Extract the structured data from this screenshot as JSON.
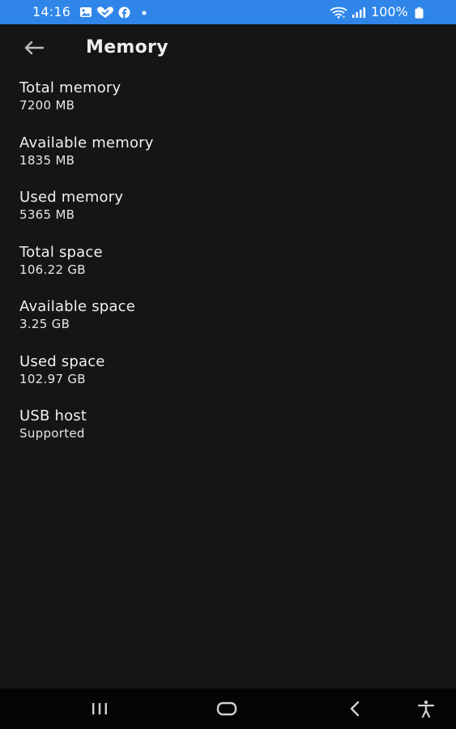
{
  "status_bar": {
    "time": "14:16",
    "battery": "100%",
    "background_color": "#2f86e8",
    "icons": [
      "image-icon",
      "heart-check-icon",
      "facebook-icon",
      "dot-icon",
      "wifi-icon",
      "signal-icon",
      "battery-icon"
    ]
  },
  "app_bar": {
    "title": "Memory",
    "back_icon": "arrow-left-icon"
  },
  "items": [
    {
      "label": "Total memory",
      "value": "7200 MB"
    },
    {
      "label": "Available memory",
      "value": "1835 MB"
    },
    {
      "label": "Used memory",
      "value": "5365 MB"
    },
    {
      "label": "Total space",
      "value": "106.22 GB"
    },
    {
      "label": "Available space",
      "value": "3.25 GB"
    },
    {
      "label": "Used space",
      "value": "102.97 GB"
    },
    {
      "label": "USB host",
      "value": "Supported"
    }
  ],
  "nav_bar": {
    "icons": [
      "recent-apps-icon",
      "home-icon",
      "back-icon",
      "accessibility-icon"
    ]
  }
}
